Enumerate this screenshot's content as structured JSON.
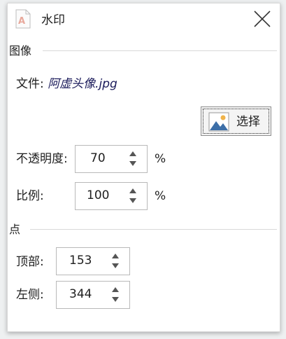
{
  "dialog": {
    "title": "水印",
    "icon": "watermark-document-icon",
    "close_icon": "close-icon"
  },
  "image_section": {
    "heading": "图像",
    "file_label": "文件:",
    "file_name": "阿虚头像.jpg",
    "choose_button": {
      "label": "选择",
      "icon": "image-icon"
    },
    "opacity": {
      "label": "不透明度:",
      "value": "70",
      "unit": "%"
    },
    "scale": {
      "label": "比例:",
      "value": "100",
      "unit": "%"
    }
  },
  "point_section": {
    "heading": "点",
    "top": {
      "label": "顶部:",
      "value": "153"
    },
    "left": {
      "label": "左侧:",
      "value": "344"
    }
  },
  "colors": {
    "window_bg": "#eef0f1",
    "dialog_bg": "#ffffff",
    "icon_accent": "#e8a99c",
    "image_icon_blue": "#3d6fa8",
    "image_icon_sun": "#f0b34a"
  }
}
